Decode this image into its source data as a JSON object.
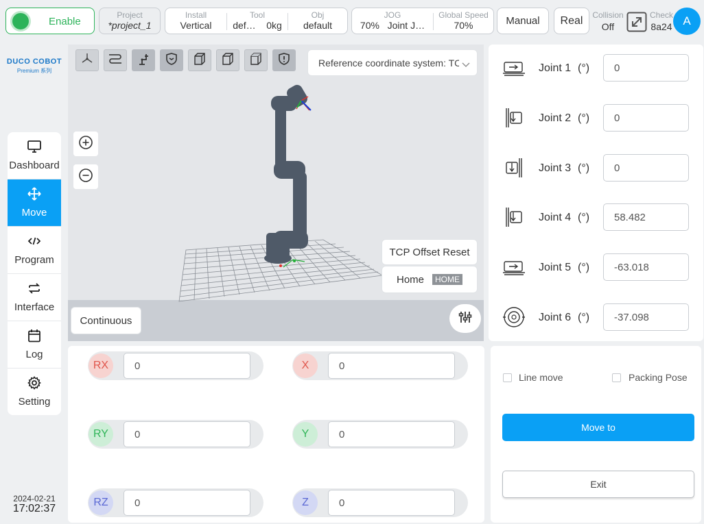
{
  "header": {
    "enable_label": "Enable",
    "project": {
      "label": "Project",
      "value": "*project_1"
    },
    "install": {
      "label": "Install",
      "value": "Vertical"
    },
    "tool": {
      "label": "Tool",
      "name": "def…",
      "weight": "0kg"
    },
    "obj": {
      "label": "Obj",
      "value": "default"
    },
    "jog": {
      "label": "JOG",
      "percent": "70%",
      "mode": "Joint J…"
    },
    "global_speed": {
      "label": "Global Speed",
      "value": "70%"
    },
    "manual_label": "Manual",
    "real_label": "Real",
    "collision": {
      "label": "Collision",
      "value": "Off"
    },
    "check": {
      "label": "Check",
      "value": "8a24"
    },
    "avatar_letter": "A"
  },
  "logo": {
    "brand": "DUCO COBOT",
    "subtitle": "Premium 系列"
  },
  "sidebar": {
    "items": [
      {
        "label": "Dashboard",
        "icon": "monitor-icon"
      },
      {
        "label": "Move",
        "icon": "move-arrows-icon"
      },
      {
        "label": "Program",
        "icon": "code-icon"
      },
      {
        "label": "Interface",
        "icon": "swap-arrows-icon"
      },
      {
        "label": "Log",
        "icon": "calendar-icon"
      },
      {
        "label": "Setting",
        "icon": "gear-icon"
      }
    ]
  },
  "datetime": {
    "date": "2024-02-21",
    "time": "17:02:37"
  },
  "viewport": {
    "reference_select": "Reference coordinate system: TCP",
    "tcp_offset_reset": "TCP Offset Reset",
    "home_label": "Home",
    "home_badge": "HOME",
    "continuous_label": "Continuous"
  },
  "joints": [
    {
      "label": "Joint 1",
      "unit": "(°)",
      "value": "0"
    },
    {
      "label": "Joint 2",
      "unit": "(°)",
      "value": "0"
    },
    {
      "label": "Joint 3",
      "unit": "(°)",
      "value": "0"
    },
    {
      "label": "Joint 4",
      "unit": "(°)",
      "value": "58.482"
    },
    {
      "label": "Joint 5",
      "unit": "(°)",
      "value": "-63.018"
    },
    {
      "label": "Joint 6",
      "unit": "(°)",
      "value": "-37.098"
    }
  ],
  "cartesian": {
    "rx": {
      "label": "RX",
      "value": "0"
    },
    "ry": {
      "label": "RY",
      "value": "0"
    },
    "rz": {
      "label": "RZ",
      "value": "0"
    },
    "x": {
      "label": "X",
      "value": "0"
    },
    "y": {
      "label": "Y",
      "value": "0"
    },
    "z": {
      "label": "Z",
      "value": "0"
    }
  },
  "move_panel": {
    "line_move_label": "Line move",
    "packing_pose_label": "Packing Pose",
    "move_to_label": "Move to",
    "exit_label": "Exit"
  },
  "colors": {
    "accent": "#0aa0f5",
    "enable_green": "#2db35a",
    "rx_badge": "#f7d3d0",
    "ry_badge": "#cdeed7",
    "rz_badge": "#d3d8f4"
  }
}
